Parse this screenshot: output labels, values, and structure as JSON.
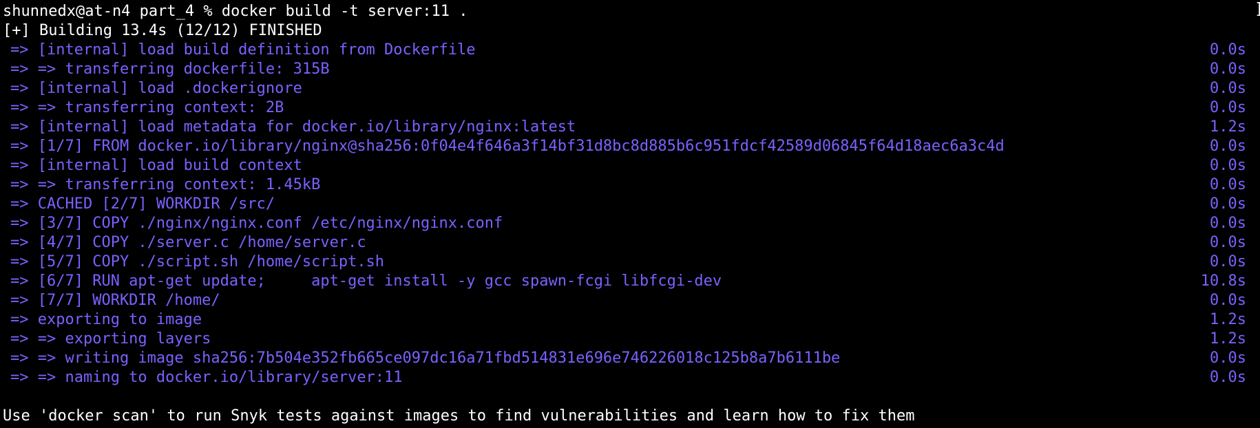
{
  "terminal": {
    "prompt": "shunnedx@at-n4 part_4 % ",
    "command": "docker build -t server:11 .",
    "status": "[+] Building 13.4s (12/12) FINISHED",
    "steps": [
      {
        "text": "=> [internal] load build definition from Dockerfile",
        "time": "0.0s"
      },
      {
        "text": "=> => transferring dockerfile: 315B",
        "time": "0.0s"
      },
      {
        "text": "=> [internal] load .dockerignore",
        "time": "0.0s"
      },
      {
        "text": "=> => transferring context: 2B",
        "time": "0.0s"
      },
      {
        "text": "=> [internal] load metadata for docker.io/library/nginx:latest",
        "time": "1.2s"
      },
      {
        "text": "=> [1/7] FROM docker.io/library/nginx@sha256:0f04e4f646a3f14bf31d8bc8d885b6c951fdcf42589d06845f64d18aec6a3c4d",
        "time": "0.0s"
      },
      {
        "text": "=> [internal] load build context",
        "time": "0.0s"
      },
      {
        "text": "=> => transferring context: 1.45kB",
        "time": "0.0s"
      },
      {
        "text": "=> CACHED [2/7] WORKDIR /src/",
        "time": "0.0s"
      },
      {
        "text": "=> [3/7] COPY ./nginx/nginx.conf /etc/nginx/nginx.conf",
        "time": "0.0s"
      },
      {
        "text": "=> [4/7] COPY ./server.c /home/server.c",
        "time": "0.0s"
      },
      {
        "text": "=> [5/7] COPY ./script.sh /home/script.sh",
        "time": "0.0s"
      },
      {
        "text": "=> [6/7] RUN apt-get update;     apt-get install -y gcc spawn-fcgi libfcgi-dev",
        "time": "10.8s"
      },
      {
        "text": "=> [7/7] WORKDIR /home/",
        "time": "0.0s"
      },
      {
        "text": "=> exporting to image",
        "time": "1.2s"
      },
      {
        "text": "=> => exporting layers",
        "time": "1.2s"
      },
      {
        "text": "=> => writing image sha256:7b504e352fb665ce097dc16a71fbd514831e696e746226018c125b8a7b6111be",
        "time": "0.0s"
      },
      {
        "text": "=> => naming to docker.io/library/server:11",
        "time": "0.0s"
      }
    ],
    "footer": "Use 'docker scan' to run Snyk tests against images to find vulnerabilities and learn how to fix them"
  },
  "colors": {
    "background": "#000000",
    "text": "#ffffff",
    "step": "#7b61ff"
  }
}
